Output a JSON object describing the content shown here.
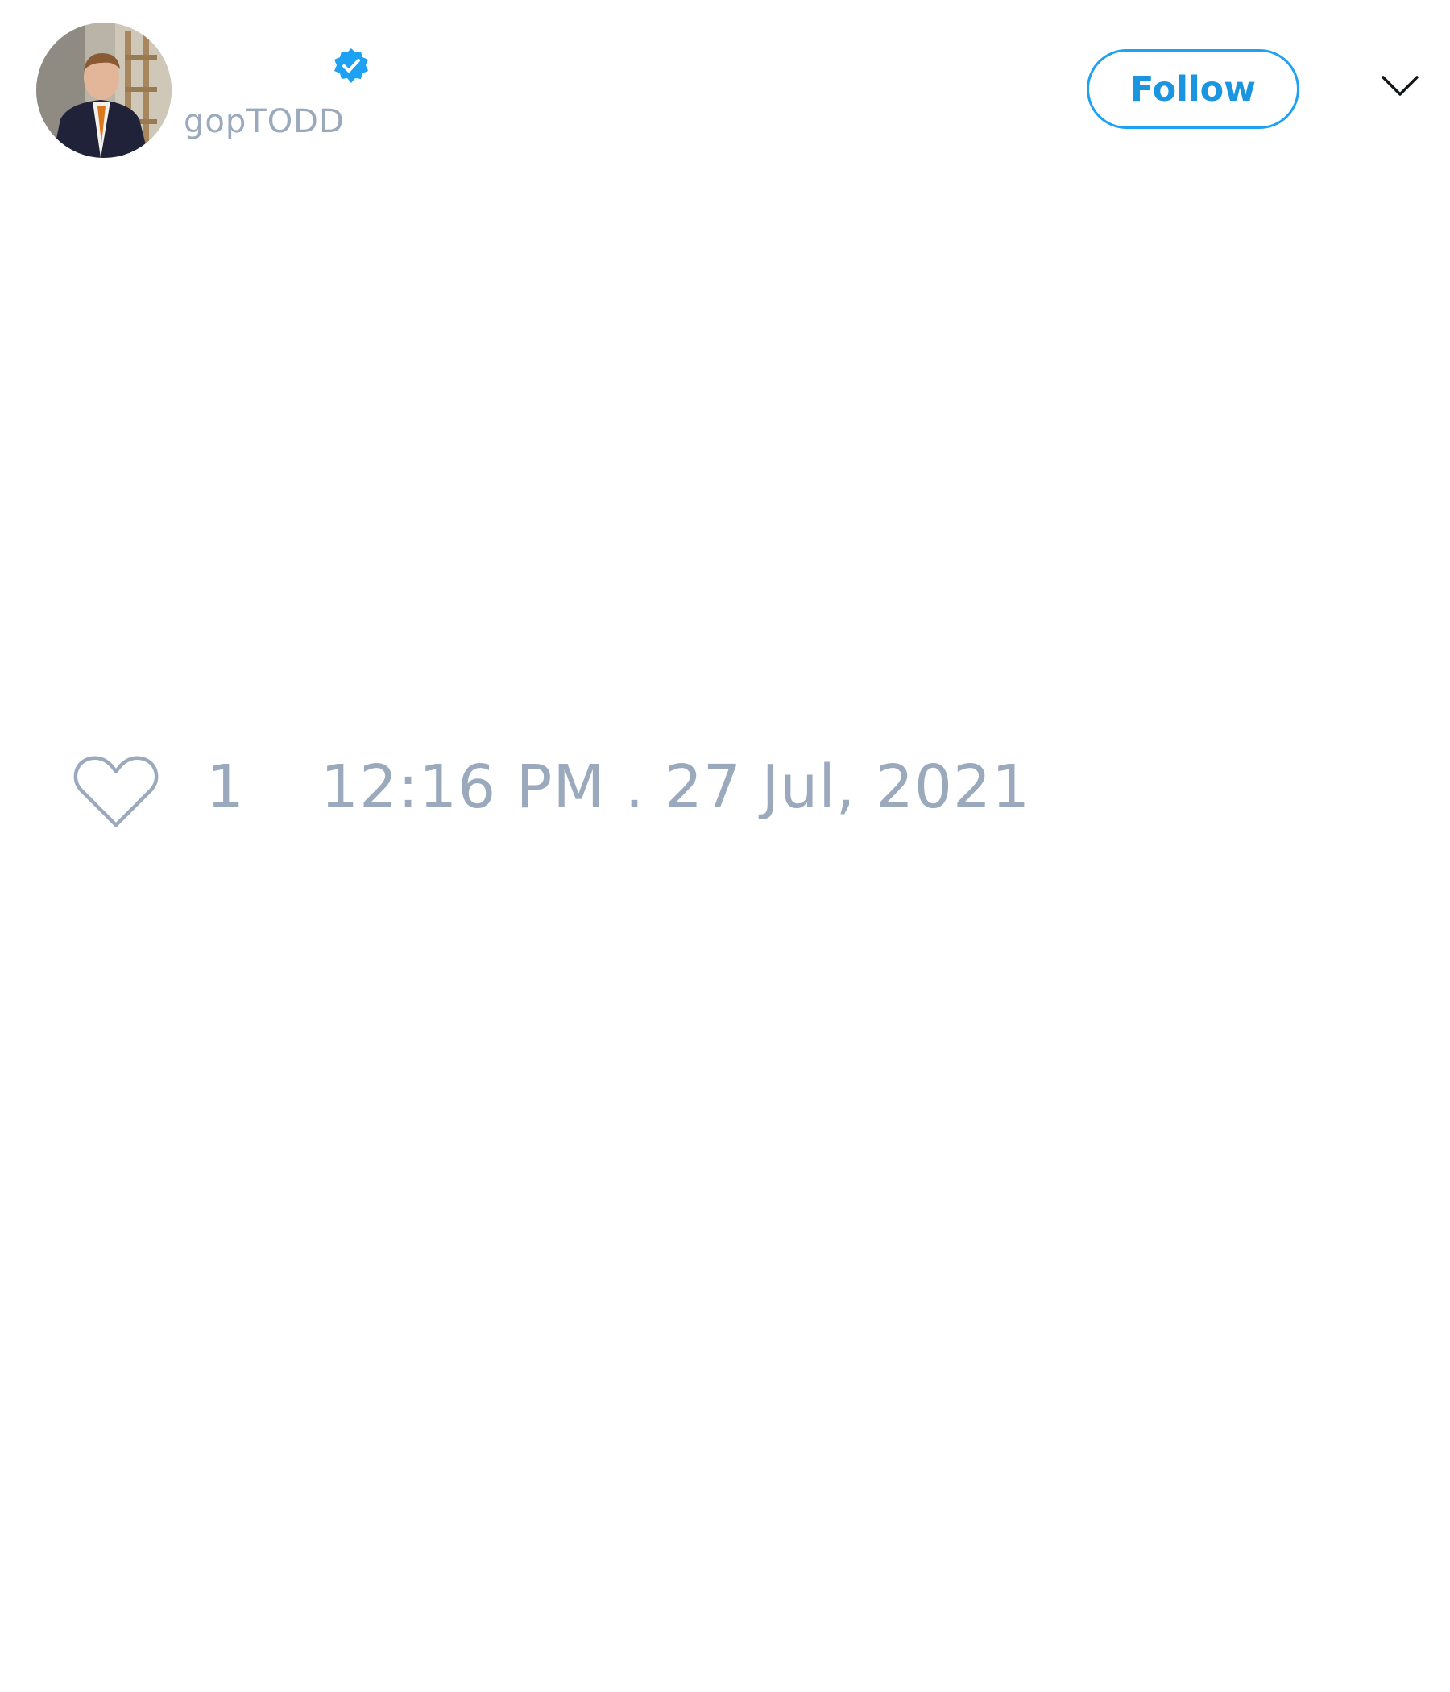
{
  "header": {
    "avatar_icon": "profile-photo",
    "verified_icon": "verified-badge-icon",
    "username": "gopTODD",
    "follow_label": "Follow",
    "menu_icon": "chevron-down-icon"
  },
  "footer": {
    "like_icon": "heart-icon",
    "like_count": "1",
    "timestamp": "12:16 PM . 27 Jul, 2021"
  },
  "colors": {
    "accent": "#1da1f2",
    "muted_text": "#9aa9bc",
    "background": "#ffffff"
  }
}
